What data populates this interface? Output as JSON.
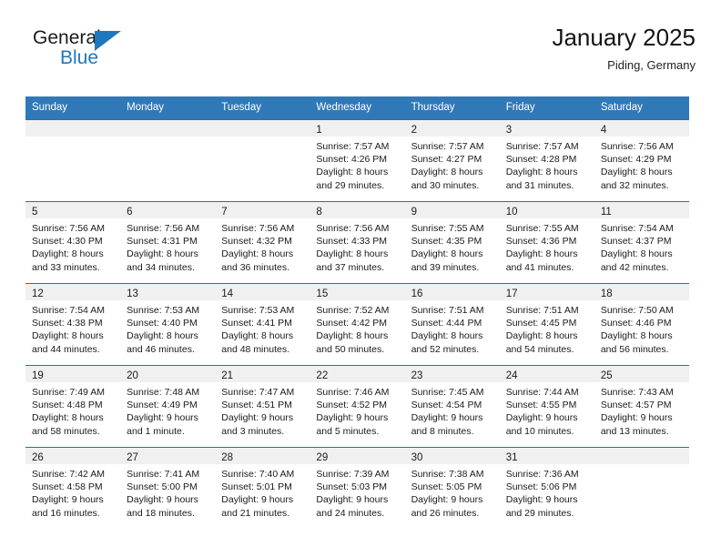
{
  "brand": {
    "name_part1": "General",
    "name_part2": "Blue",
    "accent_color": "#1f77bd"
  },
  "header": {
    "title": "January 2025",
    "location": "Piding, Germany"
  },
  "calendar": {
    "header_color": "#3079b8",
    "weekdays": [
      "Sunday",
      "Monday",
      "Tuesday",
      "Wednesday",
      "Thursday",
      "Friday",
      "Saturday"
    ],
    "weeks": [
      [
        {
          "day": "",
          "lines": []
        },
        {
          "day": "",
          "lines": []
        },
        {
          "day": "",
          "lines": []
        },
        {
          "day": "1",
          "lines": [
            "Sunrise: 7:57 AM",
            "Sunset: 4:26 PM",
            "Daylight: 8 hours",
            "and 29 minutes."
          ]
        },
        {
          "day": "2",
          "lines": [
            "Sunrise: 7:57 AM",
            "Sunset: 4:27 PM",
            "Daylight: 8 hours",
            "and 30 minutes."
          ]
        },
        {
          "day": "3",
          "lines": [
            "Sunrise: 7:57 AM",
            "Sunset: 4:28 PM",
            "Daylight: 8 hours",
            "and 31 minutes."
          ]
        },
        {
          "day": "4",
          "lines": [
            "Sunrise: 7:56 AM",
            "Sunset: 4:29 PM",
            "Daylight: 8 hours",
            "and 32 minutes."
          ]
        }
      ],
      [
        {
          "day": "5",
          "lines": [
            "Sunrise: 7:56 AM",
            "Sunset: 4:30 PM",
            "Daylight: 8 hours",
            "and 33 minutes."
          ]
        },
        {
          "day": "6",
          "lines": [
            "Sunrise: 7:56 AM",
            "Sunset: 4:31 PM",
            "Daylight: 8 hours",
            "and 34 minutes."
          ]
        },
        {
          "day": "7",
          "lines": [
            "Sunrise: 7:56 AM",
            "Sunset: 4:32 PM",
            "Daylight: 8 hours",
            "and 36 minutes."
          ]
        },
        {
          "day": "8",
          "lines": [
            "Sunrise: 7:56 AM",
            "Sunset: 4:33 PM",
            "Daylight: 8 hours",
            "and 37 minutes."
          ]
        },
        {
          "day": "9",
          "lines": [
            "Sunrise: 7:55 AM",
            "Sunset: 4:35 PM",
            "Daylight: 8 hours",
            "and 39 minutes."
          ]
        },
        {
          "day": "10",
          "lines": [
            "Sunrise: 7:55 AM",
            "Sunset: 4:36 PM",
            "Daylight: 8 hours",
            "and 41 minutes."
          ]
        },
        {
          "day": "11",
          "lines": [
            "Sunrise: 7:54 AM",
            "Sunset: 4:37 PM",
            "Daylight: 8 hours",
            "and 42 minutes."
          ]
        }
      ],
      [
        {
          "day": "12",
          "lines": [
            "Sunrise: 7:54 AM",
            "Sunset: 4:38 PM",
            "Daylight: 8 hours",
            "and 44 minutes."
          ]
        },
        {
          "day": "13",
          "lines": [
            "Sunrise: 7:53 AM",
            "Sunset: 4:40 PM",
            "Daylight: 8 hours",
            "and 46 minutes."
          ]
        },
        {
          "day": "14",
          "lines": [
            "Sunrise: 7:53 AM",
            "Sunset: 4:41 PM",
            "Daylight: 8 hours",
            "and 48 minutes."
          ]
        },
        {
          "day": "15",
          "lines": [
            "Sunrise: 7:52 AM",
            "Sunset: 4:42 PM",
            "Daylight: 8 hours",
            "and 50 minutes."
          ]
        },
        {
          "day": "16",
          "lines": [
            "Sunrise: 7:51 AM",
            "Sunset: 4:44 PM",
            "Daylight: 8 hours",
            "and 52 minutes."
          ]
        },
        {
          "day": "17",
          "lines": [
            "Sunrise: 7:51 AM",
            "Sunset: 4:45 PM",
            "Daylight: 8 hours",
            "and 54 minutes."
          ]
        },
        {
          "day": "18",
          "lines": [
            "Sunrise: 7:50 AM",
            "Sunset: 4:46 PM",
            "Daylight: 8 hours",
            "and 56 minutes."
          ]
        }
      ],
      [
        {
          "day": "19",
          "lines": [
            "Sunrise: 7:49 AM",
            "Sunset: 4:48 PM",
            "Daylight: 8 hours",
            "and 58 minutes."
          ]
        },
        {
          "day": "20",
          "lines": [
            "Sunrise: 7:48 AM",
            "Sunset: 4:49 PM",
            "Daylight: 9 hours",
            "and 1 minute."
          ]
        },
        {
          "day": "21",
          "lines": [
            "Sunrise: 7:47 AM",
            "Sunset: 4:51 PM",
            "Daylight: 9 hours",
            "and 3 minutes."
          ]
        },
        {
          "day": "22",
          "lines": [
            "Sunrise: 7:46 AM",
            "Sunset: 4:52 PM",
            "Daylight: 9 hours",
            "and 5 minutes."
          ]
        },
        {
          "day": "23",
          "lines": [
            "Sunrise: 7:45 AM",
            "Sunset: 4:54 PM",
            "Daylight: 9 hours",
            "and 8 minutes."
          ]
        },
        {
          "day": "24",
          "lines": [
            "Sunrise: 7:44 AM",
            "Sunset: 4:55 PM",
            "Daylight: 9 hours",
            "and 10 minutes."
          ]
        },
        {
          "day": "25",
          "lines": [
            "Sunrise: 7:43 AM",
            "Sunset: 4:57 PM",
            "Daylight: 9 hours",
            "and 13 minutes."
          ]
        }
      ],
      [
        {
          "day": "26",
          "lines": [
            "Sunrise: 7:42 AM",
            "Sunset: 4:58 PM",
            "Daylight: 9 hours",
            "and 16 minutes."
          ]
        },
        {
          "day": "27",
          "lines": [
            "Sunrise: 7:41 AM",
            "Sunset: 5:00 PM",
            "Daylight: 9 hours",
            "and 18 minutes."
          ]
        },
        {
          "day": "28",
          "lines": [
            "Sunrise: 7:40 AM",
            "Sunset: 5:01 PM",
            "Daylight: 9 hours",
            "and 21 minutes."
          ]
        },
        {
          "day": "29",
          "lines": [
            "Sunrise: 7:39 AM",
            "Sunset: 5:03 PM",
            "Daylight: 9 hours",
            "and 24 minutes."
          ]
        },
        {
          "day": "30",
          "lines": [
            "Sunrise: 7:38 AM",
            "Sunset: 5:05 PM",
            "Daylight: 9 hours",
            "and 26 minutes."
          ]
        },
        {
          "day": "31",
          "lines": [
            "Sunrise: 7:36 AM",
            "Sunset: 5:06 PM",
            "Daylight: 9 hours",
            "and 29 minutes."
          ]
        },
        {
          "day": "",
          "lines": []
        }
      ]
    ]
  }
}
